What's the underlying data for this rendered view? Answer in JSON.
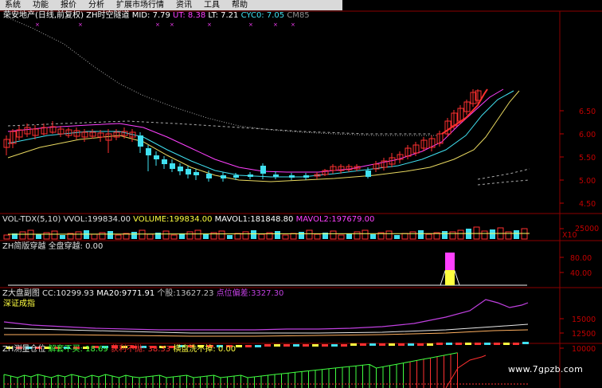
{
  "menu": {
    "items": [
      "系统",
      "功能",
      "报价",
      "分析",
      "扩展市场行情",
      "资讯",
      "工具",
      "帮助"
    ]
  },
  "main_panel": {
    "stock_name": "荣安地产(日线,前复权)",
    "indicator_name": "ZH时空隧道",
    "mid_label": "MID:",
    "mid_value": "7.79",
    "ut_label": "UT:",
    "ut_value": "8.38",
    "lt_label": "LT:",
    "lt_value": "7.21",
    "cyc_label": "CYC0:",
    "cyc_value": "7.05",
    "cm_label": "CM85",
    "axis": [
      "6.50",
      "6.00",
      "5.50",
      "5.00",
      "4.50"
    ]
  },
  "volume_panel": {
    "name": "VOL-TDX(5,10)",
    "vvol_label": "VVOL:",
    "vvol_value": "199834.00",
    "volume_label": "VOLUME:",
    "volume_value": "199834.00",
    "mavol1_label": "MAVOL1:",
    "mavol1_value": "181848.80",
    "mavol2_label": "MAVOL2:",
    "mavol2_value": "197679.00",
    "axis": [
      "25000"
    ],
    "unit": "X10"
  },
  "cross_panel": {
    "name": "ZH简版穿越",
    "item_label": "全盘穿越:",
    "item_value": "0.00",
    "axis": [
      "80.00",
      "40.00"
    ]
  },
  "index_panel": {
    "name": "Z大盘副图",
    "cc_label": "CC:",
    "cc_value": "10299.93",
    "ma_label": "MA20:",
    "ma_value": "9771.91",
    "stock_label": "个股:",
    "stock_value": "13627.23",
    "dev_label": "点位偏差:",
    "dev_value": "3327.30",
    "sub_title": "深证成指",
    "axis": [
      "15000",
      "12500",
      "10000"
    ]
  },
  "position_panel": {
    "name": "ZH测量仓位",
    "a_label": "解套不买:",
    "a_value": "18.69",
    "b_label": "获利不抛:",
    "b_value": "38.33",
    "c_label": "横盘洗不掉:",
    "c_value": "0.00"
  },
  "watermark": "www.7gpzb.com",
  "colors": {
    "up": "#ff3030",
    "down": "#40e0f0",
    "menu_bg": "#d9d9d9",
    "magenta": "#ff40ff",
    "yellow": "#ffff40",
    "green": "#40ff40"
  }
}
